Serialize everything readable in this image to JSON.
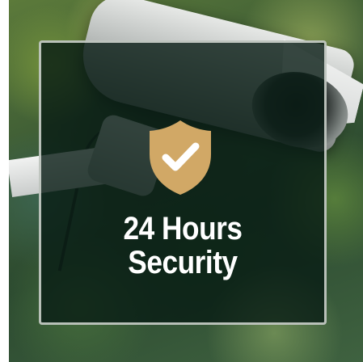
{
  "feature": {
    "line1": "24 Hours",
    "line2": "Security",
    "icon": "shield-check-icon",
    "icon_color": "#d1a866",
    "overlay_color": "#081c14"
  }
}
